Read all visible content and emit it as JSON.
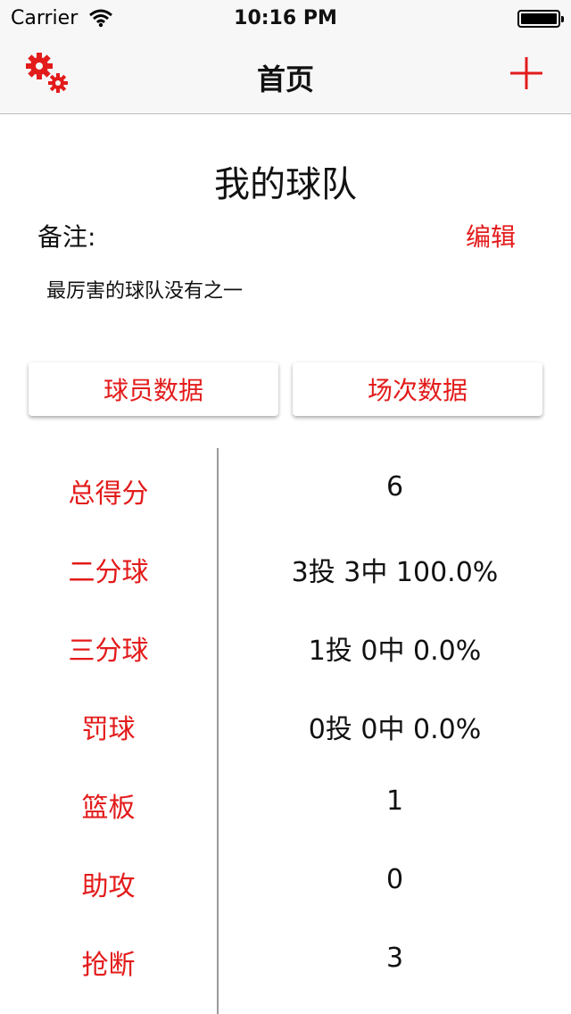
{
  "status_bar": {
    "carrier": "Carrier",
    "time": "10:16 PM",
    "battery_level": 1.0
  },
  "nav": {
    "title": "首页",
    "left_icon": "gears-icon",
    "right_icon": "plus-icon"
  },
  "team": {
    "name": "我的球队",
    "note_label": "备注:",
    "edit_label": "编辑",
    "note_text": "最厉害的球队没有之一"
  },
  "tabs": [
    {
      "label": "球员数据"
    },
    {
      "label": "场次数据"
    }
  ],
  "stats": [
    {
      "label": "总得分",
      "value": "6"
    },
    {
      "label": "二分球",
      "value": "3投 3中 100.0%"
    },
    {
      "label": "三分球",
      "value": "1投 0中 0.0%"
    },
    {
      "label": "罚球",
      "value": "0投 0中 0.0%"
    },
    {
      "label": "篮板",
      "value": "1"
    },
    {
      "label": "助攻",
      "value": "0"
    },
    {
      "label": "抢断",
      "value": "3"
    }
  ],
  "colors": {
    "accent": "#e31b1b",
    "nav_background": "#f7f7f7",
    "divider": "#9a9a9a"
  }
}
